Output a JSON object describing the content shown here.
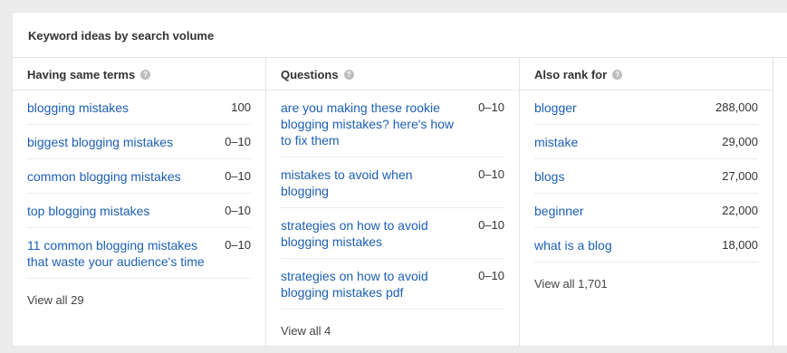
{
  "title": "Keyword ideas by search volume",
  "columns": [
    {
      "header": "Having same terms",
      "rows": [
        {
          "keyword": "blogging mistakes",
          "volume": "100"
        },
        {
          "keyword": "biggest blogging mistakes",
          "volume": "0–10"
        },
        {
          "keyword": "common blogging mistakes",
          "volume": "0–10"
        },
        {
          "keyword": "top blogging mistakes",
          "volume": "0–10"
        },
        {
          "keyword": "11 common blogging mistakes that waste your audience's time",
          "volume": "0–10"
        }
      ],
      "view_all": "View all 29"
    },
    {
      "header": "Questions",
      "rows": [
        {
          "keyword": "are you making these rookie blogging mistakes? here's how to fix them",
          "volume": "0–10"
        },
        {
          "keyword": "mistakes to avoid when blogging",
          "volume": "0–10"
        },
        {
          "keyword": "strategies on how to avoid blogging mistakes",
          "volume": "0–10"
        },
        {
          "keyword": "strategies on how to avoid blogging mistakes pdf",
          "volume": "0–10"
        }
      ],
      "view_all": "View all 4"
    },
    {
      "header": "Also rank for",
      "rows": [
        {
          "keyword": "blogger",
          "volume": "288,000"
        },
        {
          "keyword": "mistake",
          "volume": "29,000"
        },
        {
          "keyword": "blogs",
          "volume": "27,000"
        },
        {
          "keyword": "beginner",
          "volume": "22,000"
        },
        {
          "keyword": "what is a blog",
          "volume": "18,000"
        }
      ],
      "view_all": "View all 1,701"
    }
  ],
  "help_icon_glyph": "?",
  "colors": {
    "link": "#1d5fb4",
    "background": "#ececec",
    "card": "#ffffff"
  }
}
